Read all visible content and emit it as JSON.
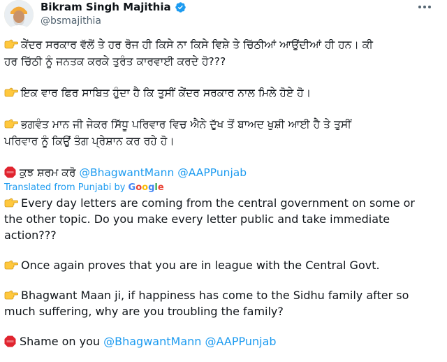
{
  "author": {
    "name": "Bikram Singh Majithia",
    "handle": "@bsmajithia"
  },
  "icons": {
    "avatar": "profile-photo",
    "verified": "verified-badge-icon",
    "more": "more-options-icon",
    "point": "backhand-index-pointing-right-emoji",
    "stop": "octagonal-sign-emoji"
  },
  "colors": {
    "accent": "#1d9bf0",
    "text": "#0f1419",
    "muted": "#536471"
  },
  "original": {
    "p1_line1": "ਕੇਂਦਰ ਸਰਕਾਰ ਵੱਲੋਂ ਤੇ ਹਰ ਰੋਜ ਹੀ ਕਿਸੇ ਨਾ ਕਿਸੇ ਵਿਸ਼ੇ ਤੇ ਚਿੱਠੀਆਂ ਆਉਂਦੀਆਂ ਹੀ ਹਨ। ਕੀ",
    "p1_line2": "ਹਰ ਚਿੱਠੀ ਨੂੰ ਜਨਤਕ ਕਰਕੇ ਤੁਰੰਤ ਕਾਰਵਾਈ ਕਰਦੇ ਹੋ???",
    "p2_line1": "ਇਕ ਵਾਰ ਫਿਰ ਸਾਬਿਤ ਹੁੰਦਾ ਹੈ ਕਿ ਤੁਸੀਂ ਕੇਂਦਰ ਸਰਕਾਰ ਨਾਲ ਮਿਲੇ ਹੋਏ ਹੋ।",
    "p3_line1": "ਭਗਵੰਤ ਮਾਨ ਜੀ ਜੇਕਰ ਸਿੱਧੂ ਪਰਿਵਾਰ ਵਿਚ ਐਨੇ ਦੁੱਖ ਤੋਂ ਬਾਅਦ ਖੁਸ਼ੀ ਆਈ ਹੈ ਤੇ ਤੁਸੀਂ",
    "p3_line2": "ਪਰਿਵਾਰ ਨੂੰ ਕਿਉਂ ਤੰਗ ਪ੍ਰੇਸ਼ਾਨ ਕਰ ਰਹੇ ਹੋ।",
    "p4_text": "ਕੁਝ ਸ਼ਰਮ ਕਰੋ",
    "mention1": "@BhagwantMann",
    "mention2": "@AAPPunjab"
  },
  "translation": {
    "label": "Translated from Punjabi by",
    "provider": [
      "G",
      "o",
      "o",
      "g",
      "l",
      "e"
    ],
    "p1_line1": "Every day letters are coming from the central government on some or",
    "p1_line2": "the other topic. Do you make every letter public and take immediate",
    "p1_line3": "action???",
    "p2_line1": "Once again proves that you are in league with the Central Govt.",
    "p3_line1": "Bhagwant Maan ji, if happiness has come to the Sidhu family after so",
    "p3_line2": "much suffering, why are you troubling the family?",
    "p4_text": "Shame on you",
    "mention1": "@BhagwantMann",
    "mention2": "@AAPPunjab"
  }
}
